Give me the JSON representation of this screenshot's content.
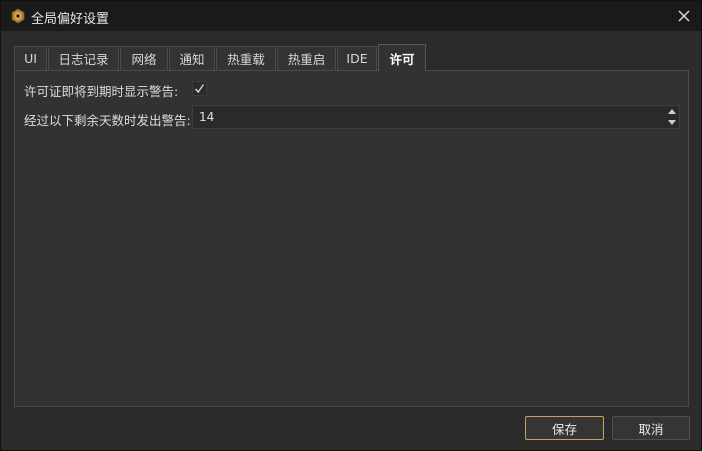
{
  "window": {
    "title": "全局偏好设置",
    "icon": "app-logo-icon"
  },
  "tabs": [
    {
      "label": "UI",
      "active": false
    },
    {
      "label": "日志记录",
      "active": false
    },
    {
      "label": "网络",
      "active": false
    },
    {
      "label": "通知",
      "active": false
    },
    {
      "label": "热重载",
      "active": false
    },
    {
      "label": "热重启",
      "active": false
    },
    {
      "label": "IDE",
      "active": false
    },
    {
      "label": "许可",
      "active": true
    }
  ],
  "license": {
    "show_warning_label": "许可证即将到期时显示警告:",
    "show_warning_checked": true,
    "days_label": "经过以下剩余天数时发出警告:",
    "days_value": "14"
  },
  "footer": {
    "save_label": "保存",
    "cancel_label": "取消"
  },
  "colors": {
    "accent": "#c8a060",
    "background": "#2b2b2b",
    "titlebar": "#1a1a1a"
  }
}
